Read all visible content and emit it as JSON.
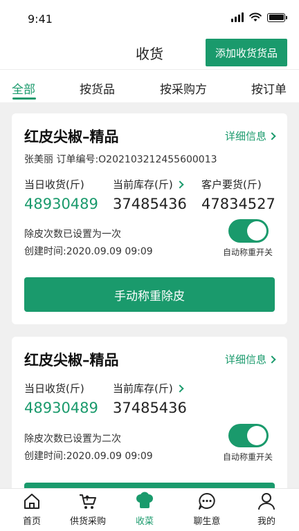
{
  "status": {
    "time": "9:41"
  },
  "nav": {
    "title": "收货",
    "action_label": "添加收货货品"
  },
  "tabs": [
    {
      "label": "全部",
      "active": true
    },
    {
      "label": "按货品",
      "active": false
    },
    {
      "label": "按采购方",
      "active": false
    },
    {
      "label": "按订单",
      "active": false
    }
  ],
  "cards": [
    {
      "title": "红皮尖椒–精品",
      "detail_label": "详细信息",
      "subtitle": "张美丽 订单编号:O202103212455600013",
      "stats": [
        {
          "label": "当日收货(斤)",
          "value": "48930489",
          "highlight": true
        },
        {
          "label": "当前库存(斤)",
          "value": "37485436",
          "has_arrow": true
        },
        {
          "label": "客户要货(斤)",
          "value": "47834527"
        }
      ],
      "tare_note": "除皮次数已设置为一次",
      "created": "创建时间:2020.09.09 09:09",
      "toggle_label": "自动称重开关",
      "toggle_on": true,
      "button_label": "手动称重除皮"
    },
    {
      "title": "红皮尖椒–精品",
      "detail_label": "详细信息",
      "stats": [
        {
          "label": "当日收货(斤)",
          "value": "48930489",
          "highlight": true
        },
        {
          "label": "当前库存(斤)",
          "value": "37485436",
          "has_arrow": true
        }
      ],
      "tare_note": "除皮次数已设置为二次",
      "created": "创建时间:2020.09.09 09:09",
      "toggle_label": "自动称重开关",
      "toggle_on": true
    }
  ],
  "tabbar": [
    {
      "label": "首页",
      "icon": "home-icon",
      "active": false
    },
    {
      "label": "供货采购",
      "icon": "basket-icon",
      "active": false
    },
    {
      "label": "收菜",
      "icon": "chef-hat-icon",
      "active": true
    },
    {
      "label": "聊生意",
      "icon": "chat-icon",
      "active": false
    },
    {
      "label": "我的",
      "icon": "user-icon",
      "active": false
    }
  ],
  "colors": {
    "accent": "#1a9a6c",
    "background": "#f0f0f0"
  }
}
